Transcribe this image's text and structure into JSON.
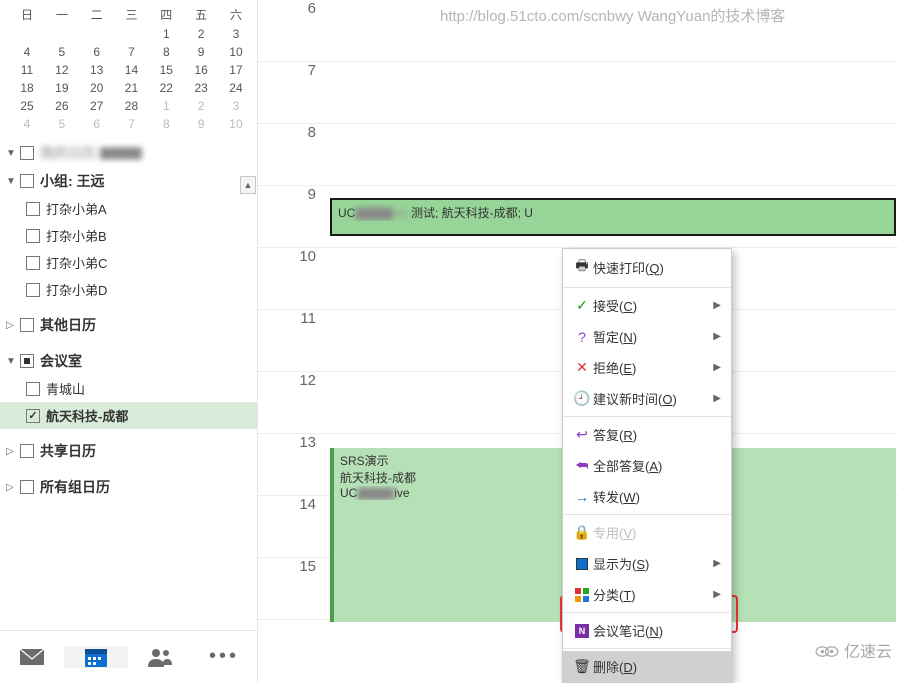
{
  "watermark": "http://blog.51cto.com/scnbwy WangYuan的技术博客",
  "brand": "亿速云",
  "minicalendar": {
    "dow": [
      "日",
      "一",
      "二",
      "三",
      "四",
      "五",
      "六"
    ],
    "weeks": [
      {
        "cells": [
          "",
          "",
          "",
          "",
          "1",
          "2",
          "3"
        ]
      },
      {
        "cells": [
          "4",
          "5",
          "6",
          "7",
          "8",
          "9",
          "10"
        ]
      },
      {
        "cells": [
          "11",
          "12",
          "13",
          "14",
          "15",
          "16",
          "17"
        ]
      },
      {
        "cells": [
          "18",
          "19",
          "20",
          "21",
          "22",
          "23",
          "24"
        ]
      },
      {
        "cells": [
          "25",
          "26",
          "27",
          "28",
          "1",
          "2",
          "3"
        ],
        "otherFrom": 4
      },
      {
        "cells": [
          "4",
          "5",
          "6",
          "7",
          "8",
          "9",
          "10"
        ],
        "otherFrom": 0
      }
    ]
  },
  "tree": {
    "blurred_group": "我的日历 ▇▇▇",
    "group_team": {
      "label": "小组: 王远",
      "expanded": true,
      "children": [
        "打杂小弟A",
        "打杂小弟B",
        "打杂小弟C",
        "打杂小弟D"
      ]
    },
    "other": {
      "label": "其他日历"
    },
    "rooms": {
      "label": "会议室",
      "expanded": true,
      "children": [
        {
          "label": "青城山",
          "checked": false
        },
        {
          "label": "航天科技-成都",
          "checked": true
        }
      ]
    },
    "shared": {
      "label": "共享日历"
    },
    "allgroups": {
      "label": "所有组日历"
    }
  },
  "hours": [
    "6",
    "7",
    "8",
    "9",
    "10",
    "11",
    "12",
    "13",
    "14",
    "15"
  ],
  "events": {
    "e1": {
      "line1": "UC",
      "line_mid_blur": "▇▇▇▇ive",
      "line1_after": "测试; 航天科技-成都; U"
    },
    "e2": {
      "line1": "SRS演示",
      "line2": "航天科技-成都",
      "line3a": "UC",
      "line3_blur": "▇▇▇▇",
      "line3b": "ive"
    }
  },
  "ctx": {
    "quickprint": "快速打印(Q)",
    "accept": "接受(C)",
    "tentative": "暂定(N)",
    "decline": "拒绝(E)",
    "propose": "建议新时间(O)",
    "reply": "答复(R)",
    "replyall": "全部答复(A)",
    "forward": "转发(W)",
    "private": "专用(V)",
    "showas": "显示为(S)",
    "categorize": "分类(T)",
    "notes": "会议笔记(N)",
    "delete": "删除(D)"
  }
}
